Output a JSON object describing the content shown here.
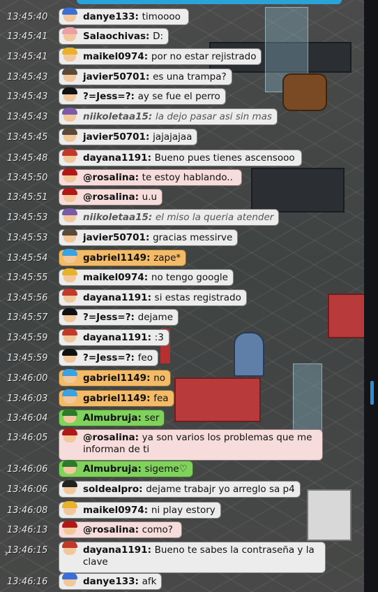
{
  "chat": [
    {
      "time": "13:45:40",
      "user": "danye133",
      "text": "timoooo",
      "style": "normal",
      "hair": "#3b6fd6"
    },
    {
      "time": "13:45:41",
      "user": "Salaochivas",
      "text": "D:",
      "style": "normal",
      "hair": "#e9a0a6"
    },
    {
      "time": "13:45:41",
      "user": "maikel0974",
      "text": "por no estar rejistrado",
      "style": "normal",
      "hair": "#e8b22d"
    },
    {
      "time": "13:45:43",
      "user": "javier50701",
      "text": "es una trampa?",
      "style": "normal",
      "hair": "#5a4a3a"
    },
    {
      "time": "13:45:43",
      "user": "?=Jess=?",
      "text": "ay se fue el perro",
      "style": "normal",
      "hair": "#111111"
    },
    {
      "time": "13:45:43",
      "user": "niikoletaa15",
      "text": "la dejo pasar asi sin mas",
      "style": "italic",
      "hair": "#7b5ba8"
    },
    {
      "time": "13:45:45",
      "user": "javier50701",
      "text": "jajajajaa",
      "style": "normal",
      "hair": "#5a4a3a"
    },
    {
      "time": "13:45:48",
      "user": "dayana1191",
      "text": "Bueno pues tienes ascensooo",
      "style": "normal",
      "hair": "#c0392b"
    },
    {
      "time": "13:45:50",
      "user": "@rosalina",
      "text": "te estoy hablando..",
      "style": "pink",
      "hair": "#b01818"
    },
    {
      "time": "13:45:51",
      "user": "@rosalina",
      "text": "u.u",
      "style": "pink",
      "hair": "#b01818"
    },
    {
      "time": "13:45:53",
      "user": "niikoletaa15",
      "text": "el miso la queria atender",
      "style": "italic",
      "hair": "#7b5ba8"
    },
    {
      "time": "13:45:53",
      "user": "javier50701",
      "text": "gracias messirve",
      "style": "normal",
      "hair": "#5a4a3a"
    },
    {
      "time": "13:45:54",
      "user": "gabriel1149",
      "text": "zape*",
      "style": "orange",
      "hair": "#3aa2e0"
    },
    {
      "time": "13:45:55",
      "user": "maikel0974",
      "text": "no tengo google",
      "style": "normal",
      "hair": "#e8b22d"
    },
    {
      "time": "13:45:56",
      "user": "dayana1191",
      "text": "si estas registrado",
      "style": "normal",
      "hair": "#c0392b"
    },
    {
      "time": "13:45:57",
      "user": "?=Jess=?",
      "text": "dejame",
      "style": "normal",
      "hair": "#111111"
    },
    {
      "time": "13:45:59",
      "user": "dayana1191",
      "text": ":3",
      "style": "normal",
      "hair": "#c0392b"
    },
    {
      "time": "13:45:59",
      "user": "?=Jess=?",
      "text": "feo",
      "style": "normal",
      "hair": "#111111"
    },
    {
      "time": "13:46:00",
      "user": "gabriel1149",
      "text": "no",
      "style": "orange",
      "hair": "#3aa2e0"
    },
    {
      "time": "13:46:03",
      "user": "gabriel1149",
      "text": "fea",
      "style": "orange",
      "hair": "#3aa2e0"
    },
    {
      "time": "13:46:04",
      "user": "Almubruja",
      "text": "ser",
      "style": "green",
      "hair": "#2f7a2a"
    },
    {
      "time": "13:46:05",
      "user": "@rosalina",
      "text": "ya son varios los problemas que me informan de ti",
      "style": "pink",
      "hair": "#b01818"
    },
    {
      "time": "13:46:06",
      "user": "Almubruja",
      "text": "sigeme♡",
      "style": "green",
      "hair": "#2f7a2a"
    },
    {
      "time": "13:46:06",
      "user": "soldealpro",
      "text": "dejame trabajr yo arreglo sa p4",
      "style": "normal",
      "hair": "#222222"
    },
    {
      "time": "13:46:08",
      "user": "maikel0974",
      "text": "ni play estory",
      "style": "normal",
      "hair": "#e8b22d"
    },
    {
      "time": "13:46:13",
      "user": "@rosalina",
      "text": "como?",
      "style": "pink",
      "hair": "#b01818"
    },
    {
      "time": "13:46:15",
      "user": "dayana1191",
      "text": "Bueno te sabes la contraseña y la clave",
      "style": "normal",
      "hair": "#c0392b"
    },
    {
      "time": "13:46:16",
      "user": "danye133",
      "text": "afk",
      "style": "normal",
      "hair": "#3b6fd6"
    }
  ],
  "icons": {
    "expand": "chevron-right-icon",
    "scroll": "scrollbar-thumb"
  },
  "accent": "#2a8fd8"
}
